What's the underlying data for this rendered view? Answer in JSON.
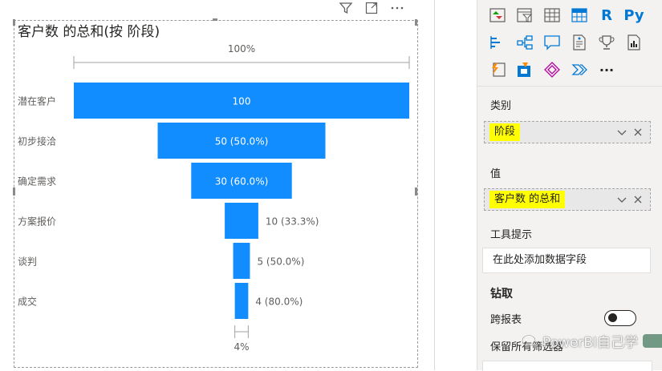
{
  "visual": {
    "title": "客户数 的总和(按 阶段)",
    "header_icons": [
      "filter-icon",
      "focus-mode-icon",
      "more-options-icon"
    ]
  },
  "chart_data": {
    "type": "funnel",
    "title": "客户数 的总和(按 阶段)",
    "top_label": "100%",
    "bottom_label": "4%",
    "bar_color": "#118dff",
    "stages": [
      {
        "category": "潜在客户",
        "value": 100,
        "label": "100"
      },
      {
        "category": "初步接洽",
        "value": 50,
        "label": "50 (50.0%)"
      },
      {
        "category": "确定需求",
        "value": 30,
        "label": "30 (60.0%)"
      },
      {
        "category": "方案报价",
        "value": 10,
        "label": "10 (33.3%)"
      },
      {
        "category": "谈判",
        "value": 5,
        "label": "5 (50.0%)"
      },
      {
        "category": "成交",
        "value": 4,
        "label": "4 (80.0%)"
      }
    ]
  },
  "pane": {
    "viz_icons": [
      [
        "kpi-icon",
        "slicer-icon",
        "table-icon",
        "matrix-icon",
        "r-visual-icon",
        "python-visual-icon"
      ],
      [
        "key-influencers-icon",
        "decomposition-tree-icon",
        "qa-icon",
        "smart-narrative-icon",
        "metric-trophy-icon",
        "paginated-report-icon"
      ],
      [
        "power-apps-icon",
        "power-automate-icon",
        "diamond-visual-icon",
        "chevron-visual-icon",
        "more-visuals-icon"
      ]
    ],
    "viz_text": {
      "r": "R",
      "py": "Py",
      "more": "···"
    },
    "category_label": "类别",
    "category_field": "阶段",
    "value_label": "值",
    "value_field": "客户数 的总和",
    "tooltip_label": "工具提示",
    "tooltip_placeholder": "在此处添加数据字段",
    "drill_heading": "钻取",
    "cross_report_label": "跨报表",
    "keep_filters_label": "保留所有筛选器",
    "cross_report_on": false
  },
  "watermark": "PowerBI自己学"
}
